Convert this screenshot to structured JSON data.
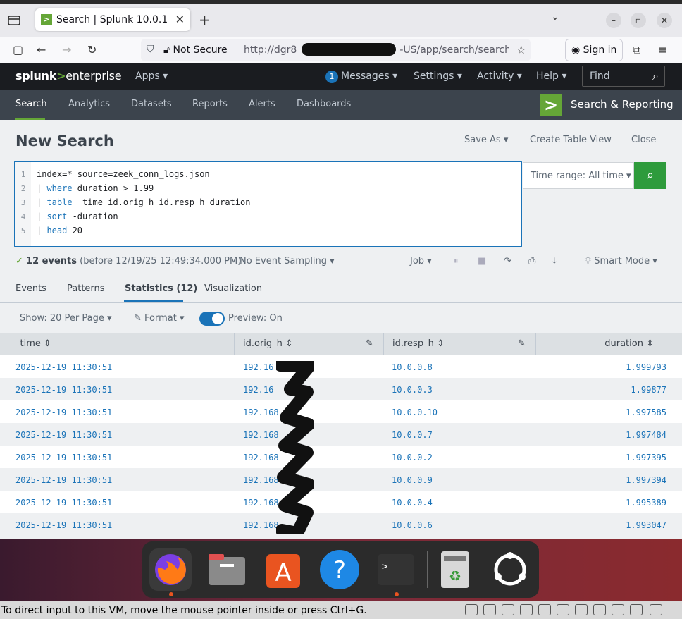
{
  "browser": {
    "tab_title": "Search | Splunk 10.0.1",
    "not_secure": "Not Secure",
    "url_start": "http://dgr8",
    "url_end": "-US/app/search/search",
    "sign_in": "Sign in"
  },
  "splunk_header": {
    "logo_splunk": "splunk",
    "logo_gt": ">",
    "logo_enterprise": "enterprise",
    "apps": "Apps ▾",
    "messages_count": "1",
    "messages": "Messages ▾",
    "settings": "Settings ▾",
    "activity": "Activity ▾",
    "help": "Help ▾",
    "find_placeholder": "Find"
  },
  "app_nav": {
    "items": [
      "Search",
      "Analytics",
      "Datasets",
      "Reports",
      "Alerts",
      "Dashboards"
    ],
    "app_name": "Search & Reporting"
  },
  "search": {
    "page_title": "New Search",
    "save_as": "Save As ▾",
    "create_table_view": "Create Table View",
    "close": "Close",
    "query_lines": [
      {
        "n": "1",
        "pipe": "",
        "kw": "",
        "rest": "index=* source=zeek_conn_logs.json"
      },
      {
        "n": "2",
        "pipe": "| ",
        "kw": "where",
        "rest": " duration > 1.99"
      },
      {
        "n": "3",
        "pipe": "| ",
        "kw": "table",
        "rest": " _time id.orig_h id.resp_h duration"
      },
      {
        "n": "4",
        "pipe": "| ",
        "kw": "sort",
        "rest": " -duration"
      },
      {
        "n": "5",
        "pipe": "| ",
        "kw": "head",
        "rest": " 20"
      }
    ],
    "time_range": "Time range: All time ▾"
  },
  "status": {
    "events_count": "12 events",
    "events_detail": "(before 12/19/25 12:49:34.000 PM)",
    "sampling": "No Event Sampling ▾",
    "job": "Job ▾",
    "smart_mode": "Smart Mode ▾"
  },
  "result_tabs": [
    "Events",
    "Patterns",
    "Statistics (12)",
    "Visualization"
  ],
  "controls": {
    "show_per_page": "Show: 20 Per Page ▾",
    "format": "Format ▾",
    "preview": "Preview: On"
  },
  "table": {
    "columns": [
      "_time",
      "id.orig_h",
      "id.resp_h",
      "duration"
    ],
    "rows": [
      {
        "time": "2025-12-19 11:30:51",
        "orig": "192.16",
        "resp": "10.0.0.8",
        "duration": "1.999793"
      },
      {
        "time": "2025-12-19 11:30:51",
        "orig": "192.16",
        "resp": "10.0.0.3",
        "duration": "1.99877"
      },
      {
        "time": "2025-12-19 11:30:51",
        "orig": "192.168",
        "resp": "10.0.0.10",
        "duration": "1.997585"
      },
      {
        "time": "2025-12-19 11:30:51",
        "orig": "192.168",
        "resp": "10.0.0.7",
        "duration": "1.997484"
      },
      {
        "time": "2025-12-19 11:30:51",
        "orig": "192.168",
        "resp": "10.0.0.2",
        "duration": "1.997395"
      },
      {
        "time": "2025-12-19 11:30:51",
        "orig": "192.168.",
        "resp": "10.0.0.9",
        "duration": "1.997394"
      },
      {
        "time": "2025-12-19 11:30:51",
        "orig": "192.168",
        "resp": "10.0.0.4",
        "duration": "1.995389"
      },
      {
        "time": "2025-12-19 11:30:51",
        "orig": "192.168.",
        "resp": "10.0.0.6",
        "duration": "1.993047"
      }
    ]
  },
  "vm_status": "To direct input to this VM, move the mouse pointer inside or press Ctrl+G."
}
